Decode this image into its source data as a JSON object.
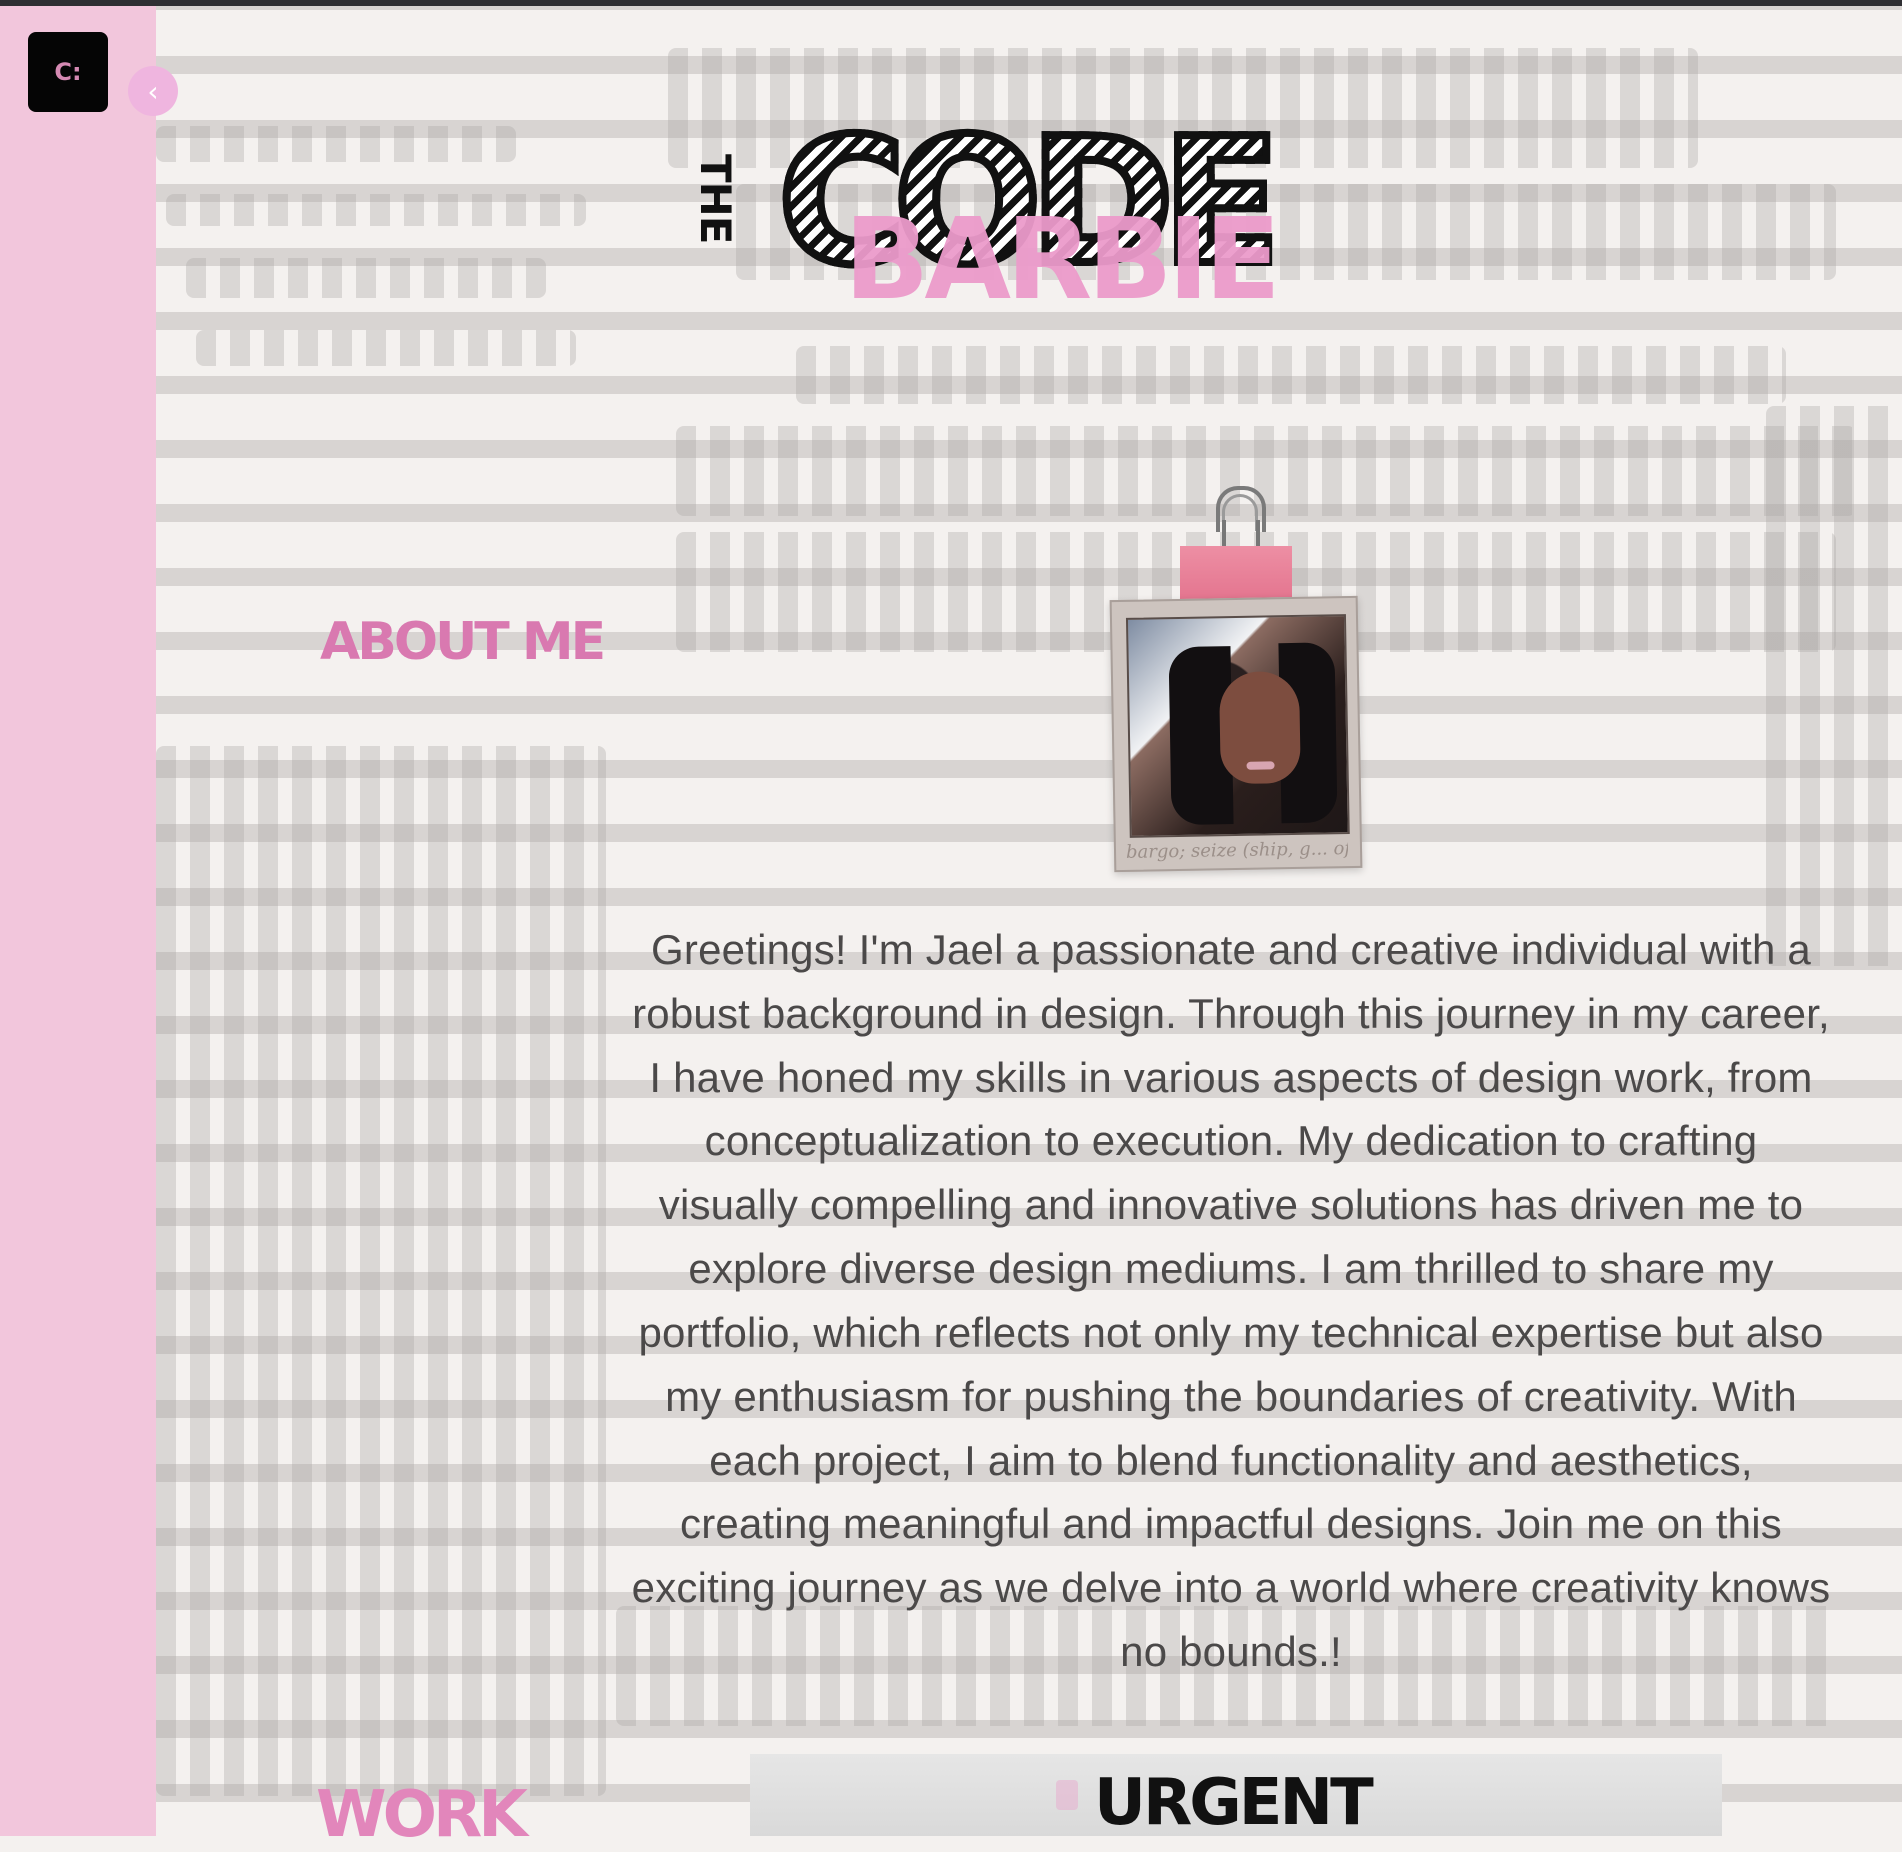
{
  "app": {
    "sidebar": {
      "logo_text": "C:",
      "back_icon": "‹"
    },
    "hero": {
      "the": "THE",
      "code": "CODE",
      "barbie": "BARBIE"
    },
    "about": {
      "heading": "ABOUT ME",
      "photo_caption": "bargo; seize (ship, g... of Rom",
      "intro": "Greetings! I'm Jael a passionate and creative individual with a robust background in design. Through this journey in my career, I have honed my skills in various aspects of design work, from conceptualization to execution. My dedication to crafting visually compelling and innovative solutions has driven me to explore diverse design mediums. I am thrilled to share my portfolio, which reflects not only my technical expertise but also my enthusiasm for pushing the boundaries of creativity. With each project, I aim to blend functionality and aesthetics, creating meaningful and impactful designs. Join me on this exciting journey as we delve into a world where creativity knows no bounds.!"
    },
    "work": {
      "heading": "WORK",
      "urgent": "URGENT"
    },
    "colors": {
      "sidebar": "#f2c6dc",
      "accent_pink": "#e286bb",
      "body_text": "#4b4949",
      "paper": "#f4f1ef"
    },
    "icons": {
      "logo": "code-logo-icon",
      "back": "chevron-left-icon",
      "clip": "binder-clip-icon"
    }
  }
}
